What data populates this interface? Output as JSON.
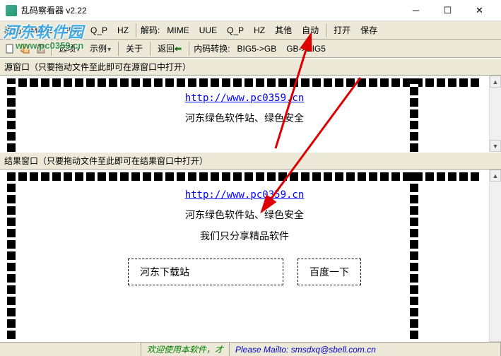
{
  "window": {
    "title": "乱码察看器 v2.22"
  },
  "toolbar1": {
    "encode_label": "编码:",
    "mime": "MIME",
    "uue": "UUE",
    "qp": "Q_P",
    "hz": "HZ",
    "decode_label": "解码:",
    "d_mime": "MIME",
    "d_uue": "UUE",
    "d_qp": "Q_P",
    "d_hz": "HZ",
    "other": "其他",
    "auto": "自动",
    "open": "打开",
    "save": "保存"
  },
  "toolbar2": {
    "options": "选项",
    "examples": "示例",
    "about": "关于",
    "back": "返回",
    "inner_convert": "内码转换:",
    "big5gb": "BIG5->GB",
    "gbbig5": "GB->BIG5"
  },
  "source": {
    "label": "源窗口（只要拖动文件至此即可在源窗口中打开）",
    "url": "http://www.pc0359.cn",
    "line1": "河东绿色软件站、绿色安全"
  },
  "result": {
    "label": "结果窗口（只要拖动文件至此即可在结果窗口中打开）",
    "url": "http://www.pc0359.cn",
    "line1": "河东绿色软件站、绿色安全",
    "line2": "我们只分享精品软件",
    "box1": "河东下载站",
    "box2": "百度一下"
  },
  "status": {
    "welcome": "欢迎使用本软件，才",
    "mailto": "Please Mailto: smsdxq@sbell.com.cn"
  },
  "watermark": {
    "name": "河东软件园",
    "url": "www.pc0359.cn"
  }
}
